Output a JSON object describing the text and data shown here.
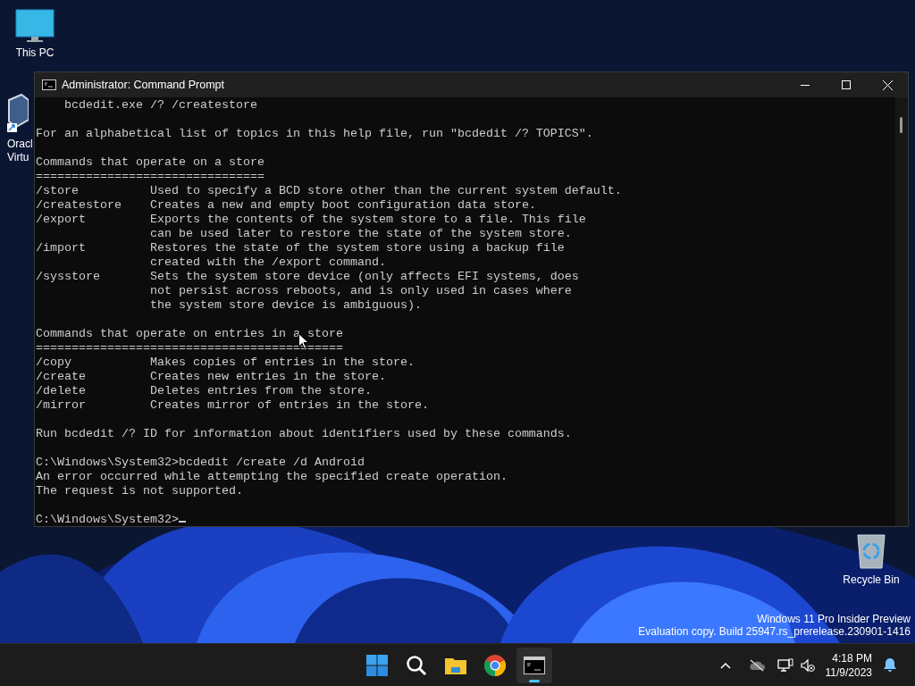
{
  "desktop_icons": [
    {
      "label": "This PC",
      "kind": "monitor"
    },
    {
      "label": "Oracl\nVirtu",
      "kind": "virtualbox"
    },
    {
      "label": "Recycle Bin",
      "kind": "recycle"
    }
  ],
  "window": {
    "title": "Administrator: Command Prompt",
    "console_blocks": [
      [
        "    bcdedit.exe /? /createstore"
      ],
      [
        "For an alphabetical list of topics in this help file, run \"bcdedit /? TOPICS\"."
      ],
      [
        "Commands that operate on a store",
        "================================",
        "/store          Used to specify a BCD store other than the current system default.",
        "/createstore    Creates a new and empty boot configuration data store.",
        "/export         Exports the contents of the system store to a file. This file",
        "                can be used later to restore the state of the system store.",
        "/import         Restores the state of the system store using a backup file",
        "                created with the /export command.",
        "/sysstore       Sets the system store device (only affects EFI systems, does",
        "                not persist across reboots, and is only used in cases where",
        "                the system store device is ambiguous)."
      ],
      [
        "Commands that operate on entries in a store",
        "===========================================",
        "/copy           Makes copies of entries in the store.",
        "/create         Creates new entries in the store.",
        "/delete         Deletes entries from the store.",
        "/mirror         Creates mirror of entries in the store."
      ],
      [
        "Run bcdedit /? ID for information about identifiers used by these commands."
      ],
      [
        "C:\\Windows\\System32>bcdedit /create /d Android",
        "An error occurred while attempting the specified create operation.",
        "The request is not supported."
      ],
      [
        "C:\\Windows\\System32>"
      ]
    ]
  },
  "watermark": [
    "Windows 11 Pro Insider Preview",
    "Evaluation copy. Build 25947.rs_prerelease.230901-1416"
  ],
  "taskbar": {
    "apps": [
      {
        "kind": "start",
        "active": false
      },
      {
        "kind": "search",
        "active": false
      },
      {
        "kind": "folder",
        "active": false
      },
      {
        "kind": "browser",
        "active": false
      },
      {
        "kind": "terminal",
        "active": true
      }
    ],
    "tray": {
      "time": "4:18 PM",
      "date": "11/9/2023"
    }
  }
}
